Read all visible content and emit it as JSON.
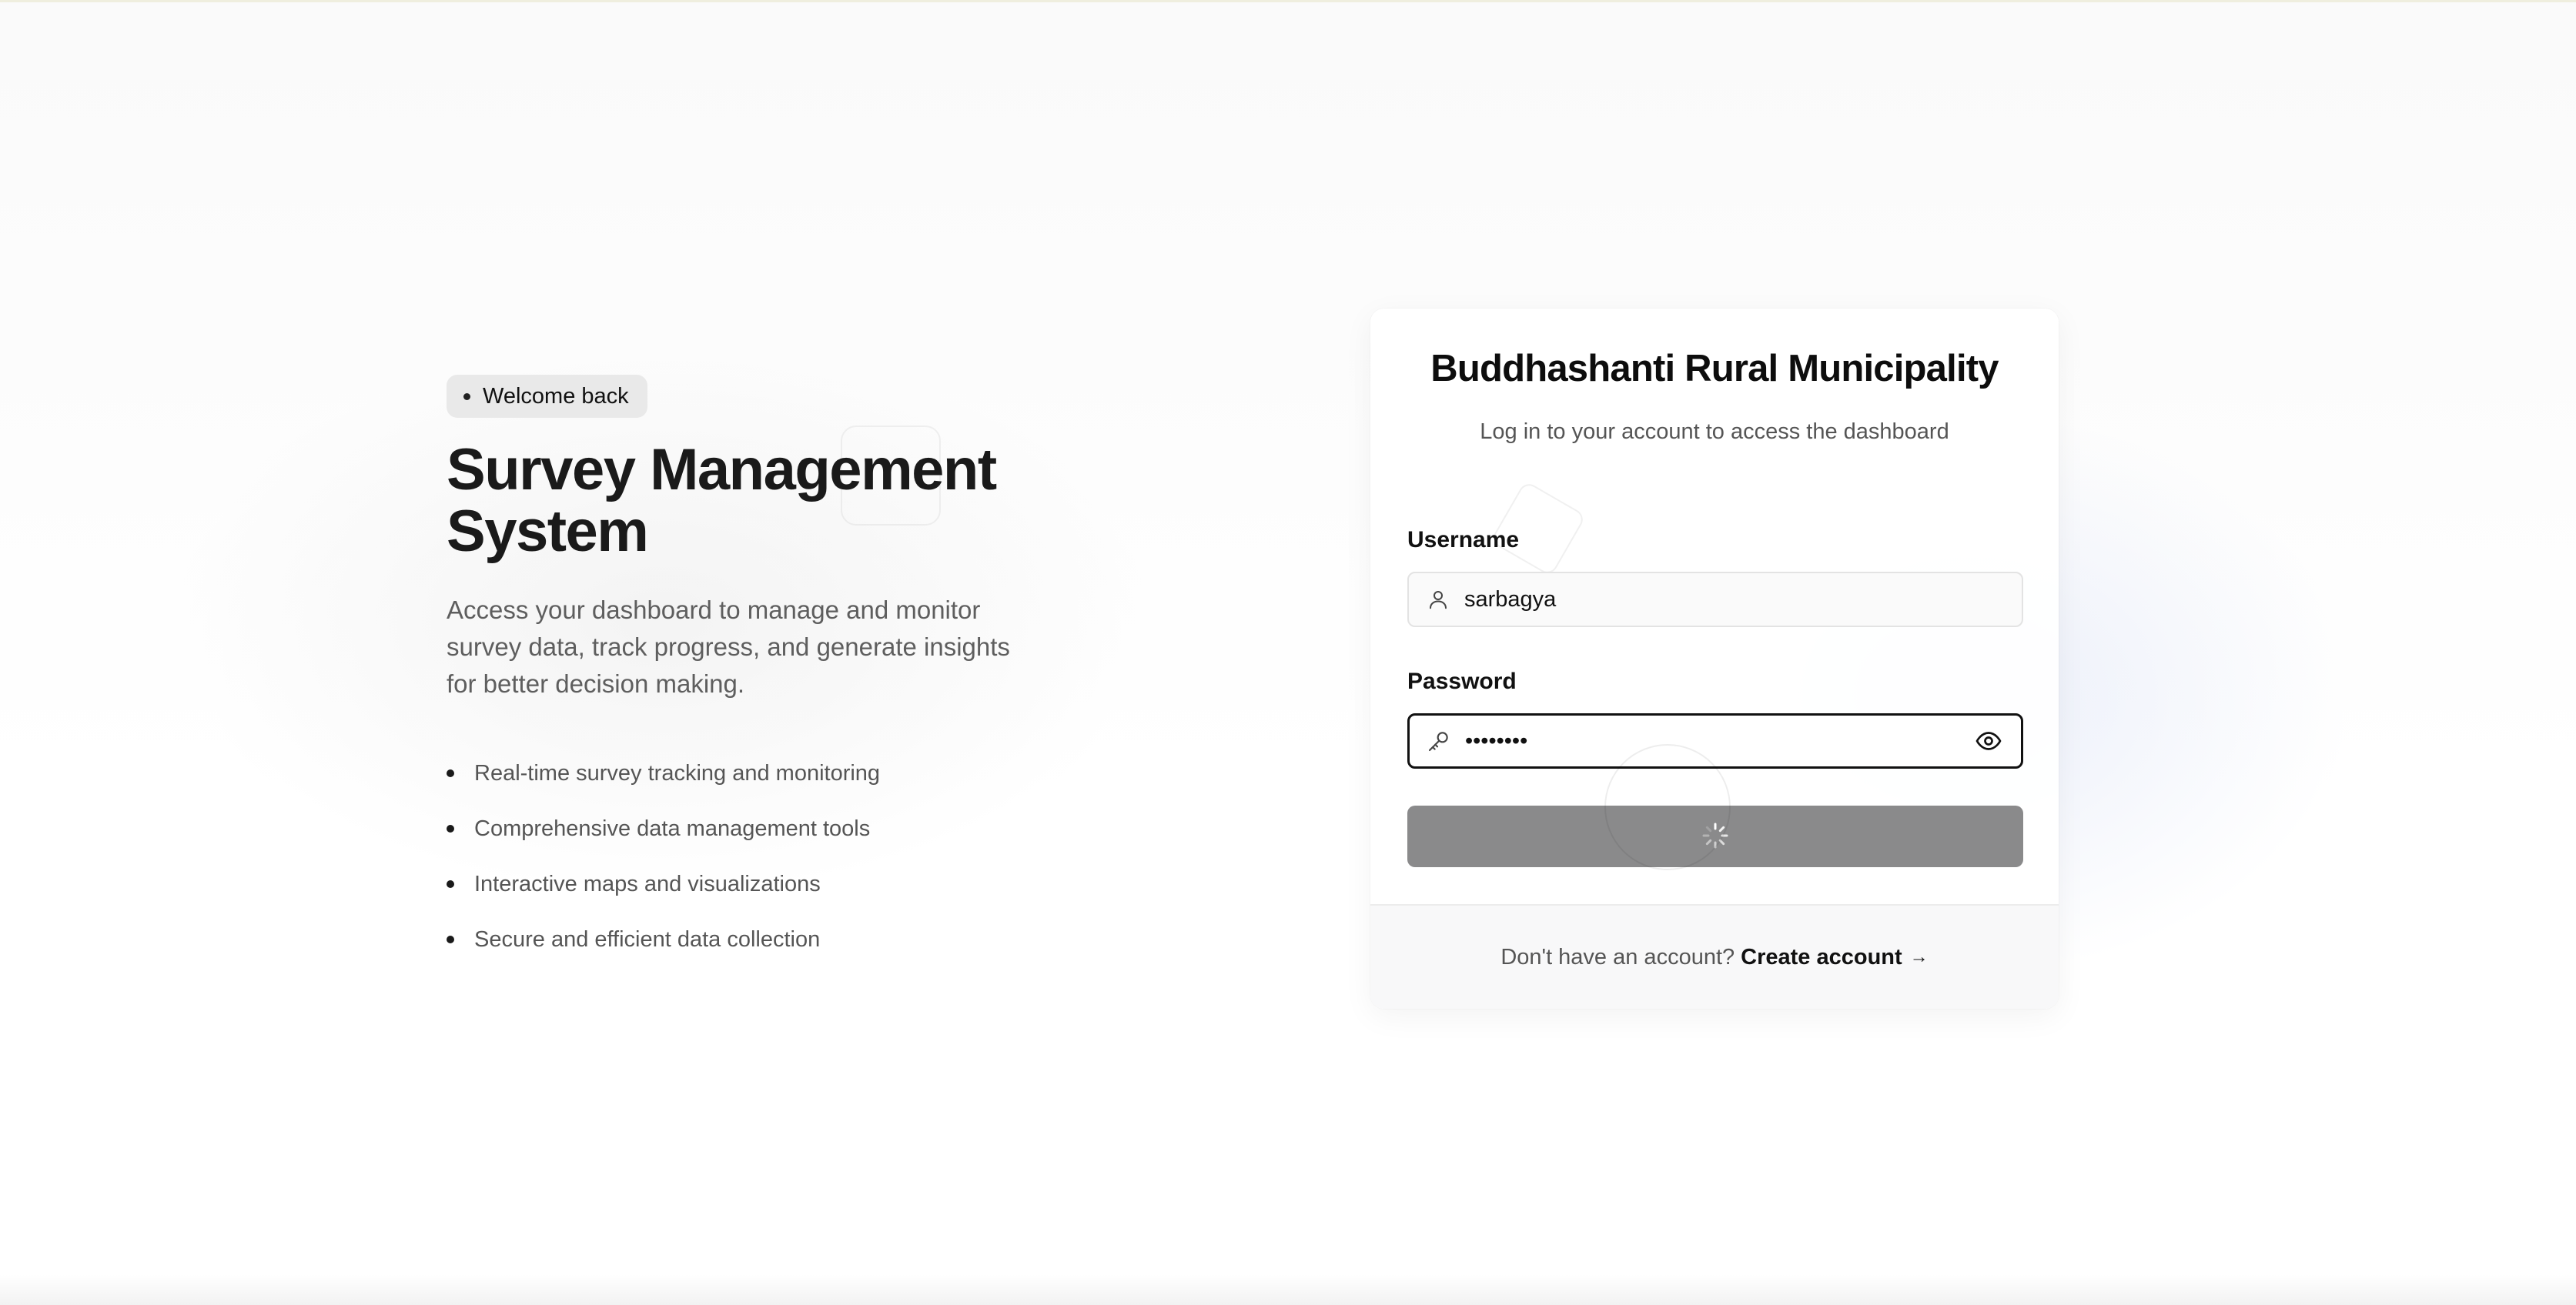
{
  "hero": {
    "badge": "Welcome back",
    "title": "Survey Management System",
    "description": "Access your dashboard to manage and monitor survey data, track progress, and generate insights for better decision making.",
    "features": [
      "Real-time survey tracking and monitoring",
      "Comprehensive data management tools",
      "Interactive maps and visualizations",
      "Secure and efficient data collection"
    ]
  },
  "login": {
    "title": "Buddhashanti Rural Municipality",
    "subtitle": "Log in to your account to access the dashboard",
    "username_label": "Username",
    "username_value": "sarbagya",
    "password_label": "Password",
    "password_value": "••••••••",
    "submit_state": "loading",
    "footer_prompt": "Don't have an account?",
    "footer_link": "Create account",
    "footer_arrow": "→"
  },
  "icons": {
    "username": "user-icon",
    "password": "key-icon",
    "toggle": "eye-icon",
    "submit": "spinner-icon"
  },
  "colors": {
    "button_disabled": "#8a8a8b",
    "badge_bg": "#e9e9e9",
    "text_primary": "#111111",
    "text_muted": "#555555"
  }
}
